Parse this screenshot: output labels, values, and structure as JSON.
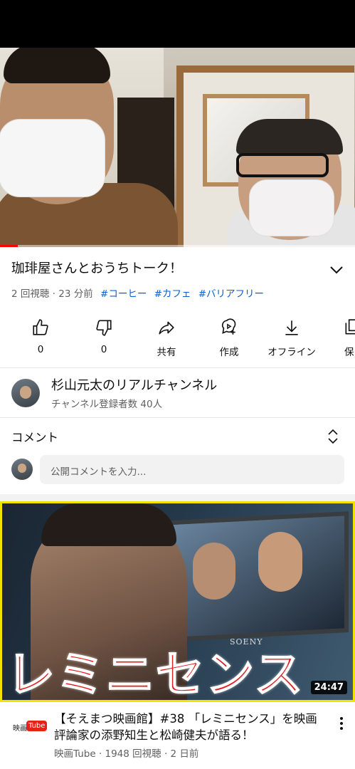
{
  "video": {
    "title": "珈琲屋さんとおうちトーク！",
    "views_time": "2 回視聴 · 23 分前",
    "hashtags": [
      "#コーヒー",
      "#カフェ",
      "#バリアフリー"
    ],
    "progress_fraction": 0.05
  },
  "actions": [
    {
      "icon": "thumbs-up-icon",
      "label": "0"
    },
    {
      "icon": "thumbs-down-icon",
      "label": "0"
    },
    {
      "icon": "share-icon",
      "label": "共有"
    },
    {
      "icon": "remix-icon",
      "label": "作成"
    },
    {
      "icon": "download-icon",
      "label": "オフライン"
    },
    {
      "icon": "save-icon",
      "label": "保"
    }
  ],
  "channel": {
    "name": "杉山元太のリアルチャンネル",
    "subscribers": "チャンネル登録者数 40人"
  },
  "comments": {
    "header": "コメント",
    "placeholder": "公開コメントを入力..."
  },
  "recommended": {
    "thumbnail_text": "レミニセンス",
    "thumbnail_sign": "SOENY",
    "duration": "24:47",
    "channel_logo": [
      "映画",
      "Tube"
    ],
    "title": "【そえまつ映画館】#38 「レミニセンス」を映画評論家の添野知生と松崎健夫が語る！",
    "meta": "映画Tube · 1948 回視聴 · 2 日前"
  },
  "colors": {
    "accent_red": "#ff0000",
    "link_blue": "#065fd4",
    "secondary_text": "#606060",
    "thumbnail_border": "#f0e300"
  }
}
